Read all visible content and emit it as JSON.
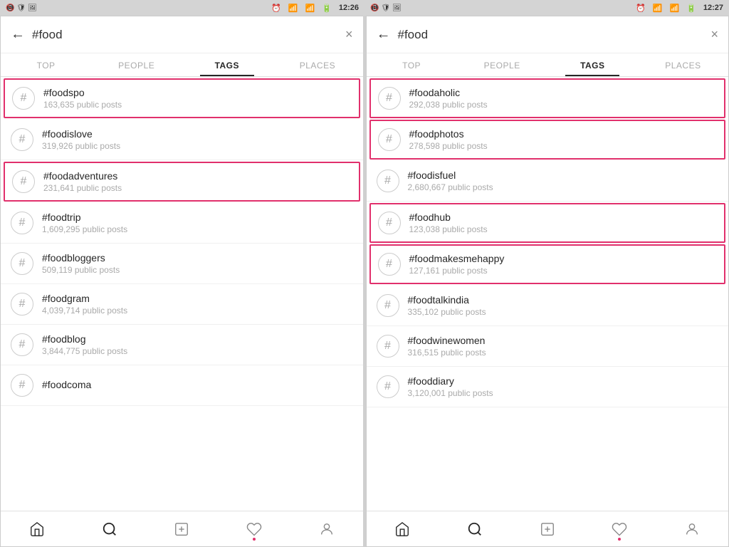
{
  "statusBar": {
    "left": {
      "time": "12:26",
      "icons": [
        "📵",
        "🛡",
        "🖼"
      ]
    },
    "right": {
      "time": "12:27",
      "icons": [
        "📵",
        "🛡",
        "🖼"
      ]
    }
  },
  "panels": [
    {
      "id": "panel-left",
      "searchQuery": "#food",
      "tabs": [
        "TOP",
        "PEOPLE",
        "TAGS",
        "PLACES"
      ],
      "activeTab": "TAGS",
      "tags": [
        {
          "name": "#foodspo",
          "count": "163,635 public posts",
          "highlighted": true
        },
        {
          "name": "#foodislove",
          "count": "319,926 public posts",
          "highlighted": false
        },
        {
          "name": "#foodadventures",
          "count": "231,641 public posts",
          "highlighted": true
        },
        {
          "name": "#foodtrip",
          "count": "1,609,295 public posts",
          "highlighted": false
        },
        {
          "name": "#foodbloggers",
          "count": "509,119 public posts",
          "highlighted": false
        },
        {
          "name": "#foodgram",
          "count": "4,039,714 public posts",
          "highlighted": false
        },
        {
          "name": "#foodblog",
          "count": "3,844,775 public posts",
          "highlighted": false
        },
        {
          "name": "#foodcoma",
          "count": "",
          "highlighted": false
        }
      ],
      "bottomNav": [
        {
          "icon": "🏠",
          "name": "home"
        },
        {
          "icon": "🔍",
          "name": "search",
          "active": true
        },
        {
          "icon": "➕",
          "name": "add"
        },
        {
          "icon": "♡",
          "name": "activity"
        },
        {
          "icon": "👤",
          "name": "profile"
        }
      ]
    },
    {
      "id": "panel-right",
      "searchQuery": "#food",
      "tabs": [
        "TOP",
        "PEOPLE",
        "TAGS",
        "PLACES"
      ],
      "activeTab": "TAGS",
      "tags": [
        {
          "name": "#foodaholic",
          "count": "292,038 public posts",
          "highlighted": true
        },
        {
          "name": "#foodphotos",
          "count": "278,598 public posts",
          "highlighted": true
        },
        {
          "name": "#foodisfuel",
          "count": "2,680,667 public posts",
          "highlighted": false
        },
        {
          "name": "#foodhub",
          "count": "123,038 public posts",
          "highlighted": true
        },
        {
          "name": "#foodmakesmehappy",
          "count": "127,161 public posts",
          "highlighted": true
        },
        {
          "name": "#foodtalkindia",
          "count": "335,102 public posts",
          "highlighted": false
        },
        {
          "name": "#foodwinewomen",
          "count": "316,515 public posts",
          "highlighted": false
        },
        {
          "name": "#fooddiary",
          "count": "3,120,001 public posts",
          "highlighted": false
        }
      ],
      "bottomNav": [
        {
          "icon": "🏠",
          "name": "home"
        },
        {
          "icon": "🔍",
          "name": "search",
          "active": true
        },
        {
          "icon": "➕",
          "name": "add"
        },
        {
          "icon": "♡",
          "name": "activity"
        },
        {
          "icon": "👤",
          "name": "profile"
        }
      ]
    }
  ]
}
